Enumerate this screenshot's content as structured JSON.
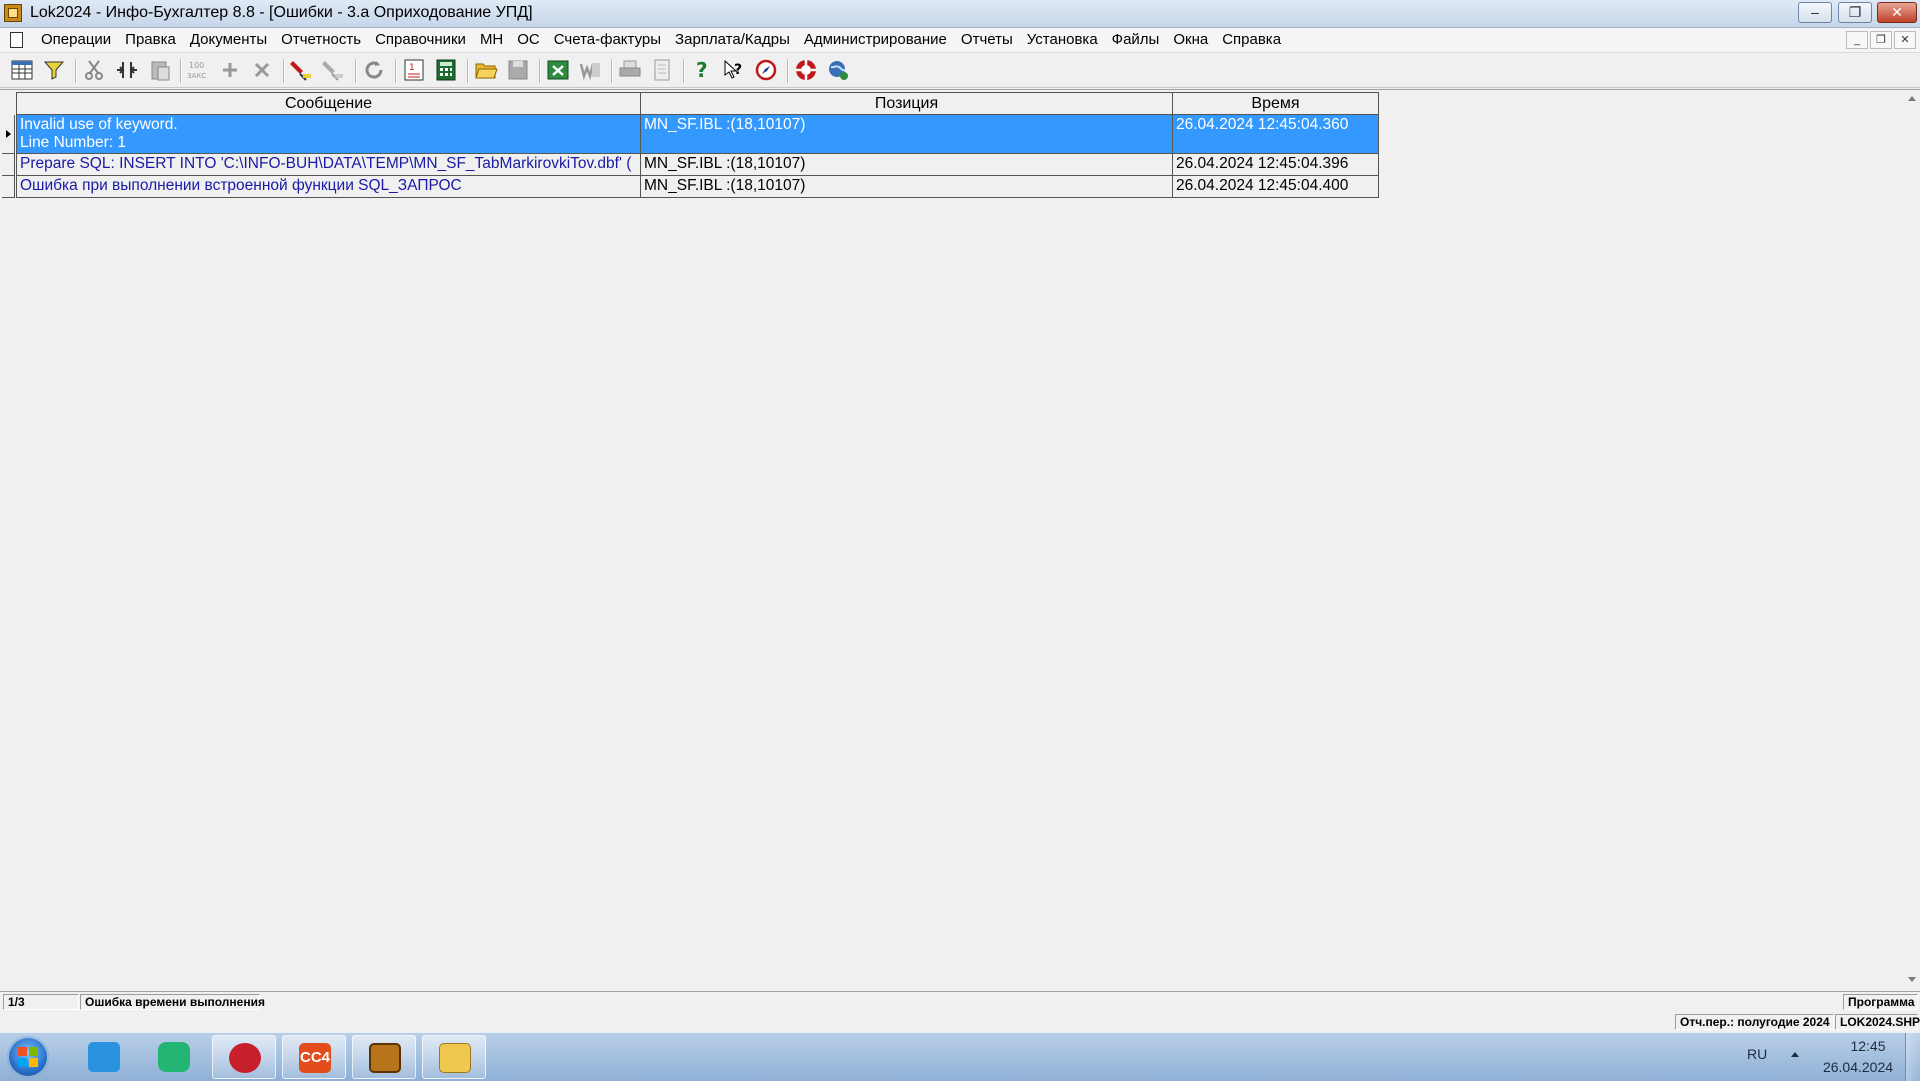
{
  "window": {
    "title": "Lok2024 - Инфо-Бухгалтер 8.8 - [Ошибки -   3.а Оприходование УПД]",
    "controls": {
      "minimize": "‒",
      "restore": "❐",
      "close": "✕"
    }
  },
  "menu": {
    "items": [
      "Операции",
      "Правка",
      "Документы",
      "Отчетность",
      "Справочники",
      "МН",
      "ОС",
      "Счета-фактуры",
      "Зарплата/Кадры",
      "Администрирование",
      "Отчеты",
      "Установка",
      "Файлы",
      "Окна",
      "Справка"
    ],
    "mdi": {
      "minimize": "_",
      "restore": "❐",
      "close": "✕"
    }
  },
  "toolbar": {
    "icons": [
      "table-view-icon",
      "filter-icon",
      "cut-icon",
      "column-width-icon",
      "paste-icon",
      "numbering-icon",
      "add-icon",
      "delete-icon",
      "mark-icon",
      "unmark-icon",
      "refresh-icon",
      "report-icon",
      "calculator-icon",
      "open-folder-icon",
      "save-icon",
      "excel-icon",
      "word-icon",
      "print-icon",
      "print-preview-icon",
      "help-icon",
      "context-help-icon",
      "compass-icon",
      "support-icon",
      "web-icon"
    ]
  },
  "grid": {
    "columns": [
      "Сообщение",
      "Позиция",
      "Время"
    ],
    "rows": [
      {
        "message": "Invalid use of keyword.",
        "message_line2": "Line Number: 1",
        "position": "MN_SF.IBL :(18,10107)",
        "time": "26.04.2024 12:45:04.360",
        "selected": true
      },
      {
        "message": "Prepare SQL: INSERT INTO 'C:\\INFO-BUH\\DATA\\TEMP\\MN_SF_TabMarkirovkiTov.dbf' (",
        "message_line2": "",
        "position": "MN_SF.IBL :(18,10107)",
        "time": "26.04.2024 12:45:04.396",
        "selected": false
      },
      {
        "message": "Ошибка при выполнении встроенной функции SQL_ЗАПРОС",
        "message_line2": "",
        "position": "MN_SF.IBL :(18,10107)",
        "time": "26.04.2024 12:45:04.400",
        "selected": false
      }
    ]
  },
  "status": {
    "record": "1/3",
    "message": "Ошибка времени выполнения",
    "right": "Программа",
    "period": "Отч.пер.: полугодие 2024",
    "file": "LOK2024.SHP"
  },
  "taskbar": {
    "apps": [
      "messenger-icon",
      "chat-icon",
      "antivirus-icon",
      "cc4-icon",
      "abacus-icon",
      "explorer-icon"
    ],
    "cc4_label": "CC4",
    "language": "RU",
    "time": "12:45",
    "date": "26.04.2024"
  },
  "colors": {
    "selection": "#3399ff",
    "message_text": "#1a1aa6",
    "titlebar": "#c6d6ea"
  }
}
